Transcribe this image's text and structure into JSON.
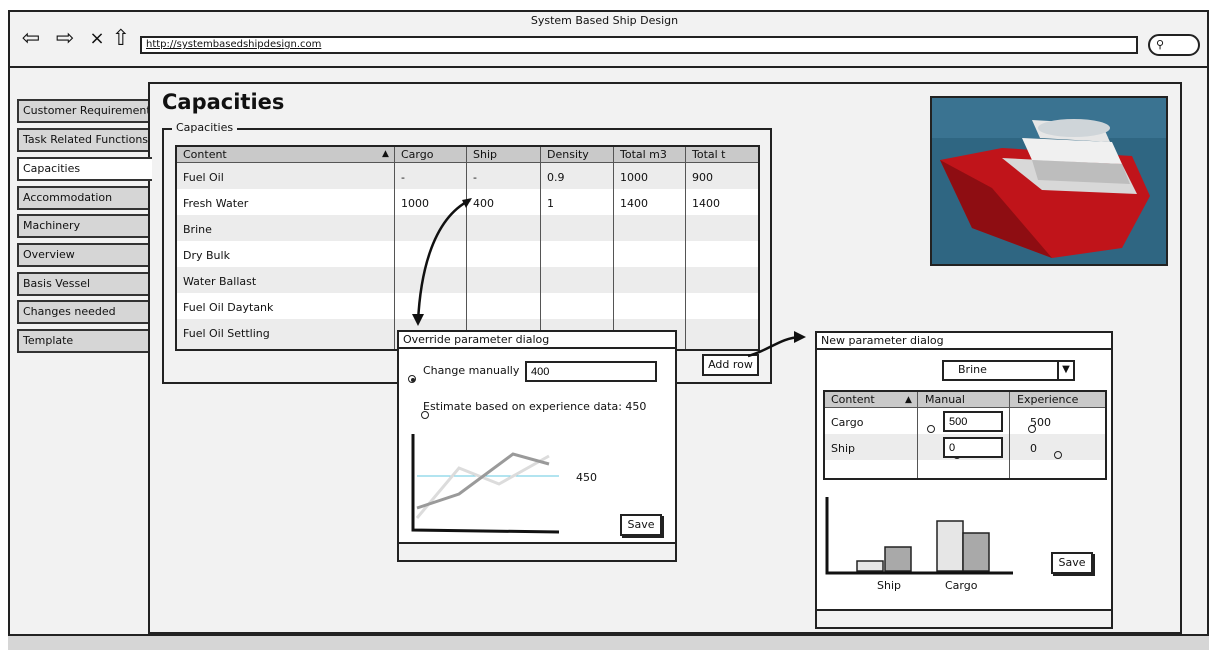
{
  "window": {
    "title": "System Based Ship Design",
    "url": "http://systembasedshipdesign.com"
  },
  "icons": {
    "back": "back-arrow-icon",
    "forward": "forward-arrow-icon",
    "stop": "close-icon",
    "home": "home-icon",
    "search": "search-icon"
  },
  "sidebar": {
    "items": [
      {
        "label": "Customer Requirements",
        "active": false
      },
      {
        "label": "Task Related Functions",
        "active": false
      },
      {
        "label": "Capacities",
        "active": true
      },
      {
        "label": "Accommodation",
        "active": false
      },
      {
        "label": "Machinery",
        "active": false
      },
      {
        "label": "Overview",
        "active": false
      },
      {
        "label": "Basis Vessel",
        "active": false
      },
      {
        "label": "Changes needed",
        "active": false
      },
      {
        "label": "Template",
        "active": false
      }
    ]
  },
  "main": {
    "title": "Capacities",
    "group_label": "Capacities",
    "table": {
      "headers": [
        "Content",
        "Cargo",
        "Ship",
        "Density",
        "Total m3",
        "Total t"
      ],
      "rows": [
        [
          "Fuel Oil",
          "-",
          "-",
          "0.9",
          "1000",
          "900"
        ],
        [
          "Fresh Water",
          "1000",
          "400",
          "1",
          "1400",
          "1400"
        ],
        [
          "Brine",
          "",
          "",
          "",
          "",
          ""
        ],
        [
          "Dry Bulk",
          "",
          "",
          "",
          "",
          ""
        ],
        [
          "Water Ballast",
          "",
          "",
          "",
          "",
          ""
        ],
        [
          "Fuel Oil Daytank",
          "",
          "",
          "",
          "",
          ""
        ],
        [
          "Fuel Oil Settling",
          "",
          "",
          "",
          "",
          ""
        ]
      ]
    },
    "add_row_label": "Add row"
  },
  "override_dialog": {
    "title": "Override parameter dialog",
    "manual_label": "Change manually",
    "manual_value": "400",
    "estimate_label": "Estimate based on experience data: 450",
    "chart_annotation": "450",
    "save_label": "Save"
  },
  "new_param_dialog": {
    "title": "New parameter dialog",
    "selected": "Brine",
    "table": {
      "headers": [
        "Content",
        "Manual",
        "Experience"
      ],
      "rows": [
        {
          "content": "Cargo",
          "manual": "500",
          "experience": "500"
        },
        {
          "content": "Ship",
          "manual": "0",
          "experience": "0"
        }
      ]
    },
    "chart_labels": [
      "Ship",
      "Cargo"
    ],
    "save_label": "Save"
  }
}
